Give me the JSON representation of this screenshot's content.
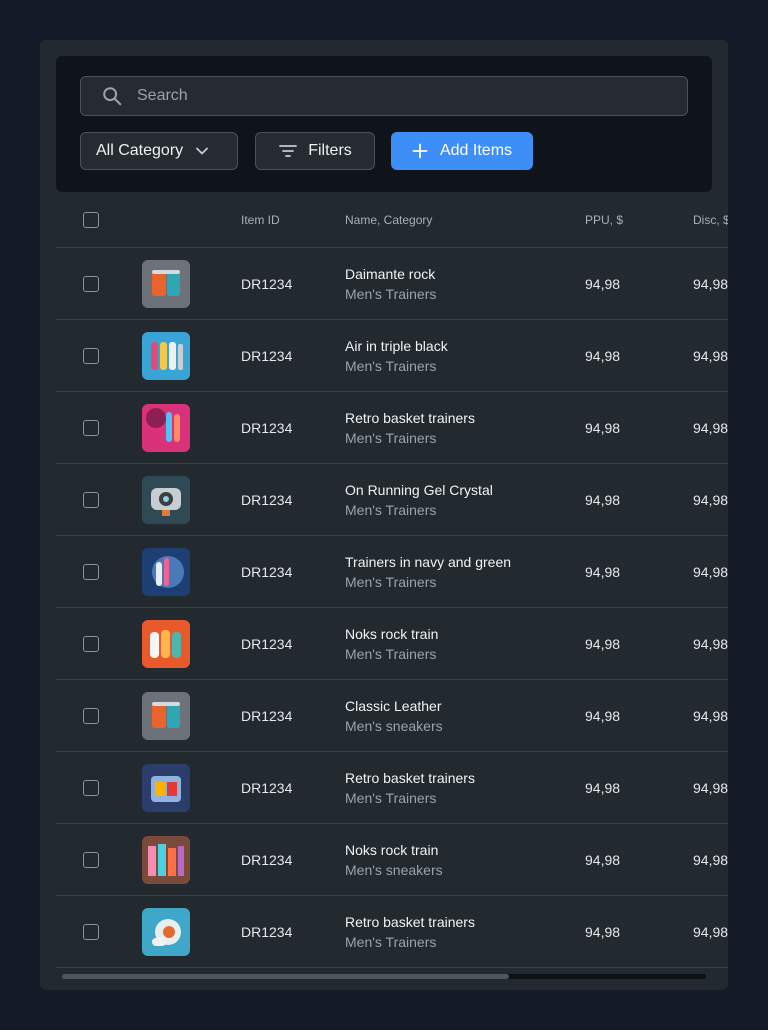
{
  "search": {
    "placeholder": "Search",
    "value": ""
  },
  "toolbar": {
    "category_label": "All Category",
    "filters_label": "Filters",
    "add_label": "Add Items"
  },
  "columns": {
    "item_id": "Item ID",
    "name_category": "Name, Category",
    "ppu": "PPU, $",
    "disc": "Disc, $"
  },
  "rows": [
    {
      "id": "DR1234",
      "name": "Daimante rock",
      "category": "Men's Trainers",
      "ppu": "94,98",
      "disc": "94,98"
    },
    {
      "id": "DR1234",
      "name": "Air in triple black",
      "category": "Men's Trainers",
      "ppu": "94,98",
      "disc": "94,98"
    },
    {
      "id": "DR1234",
      "name": "Retro basket trainers",
      "category": "Men's Trainers",
      "ppu": "94,98",
      "disc": "94,98"
    },
    {
      "id": "DR1234",
      "name": "On Running Gel Crystal",
      "category": "Men's Trainers",
      "ppu": "94,98",
      "disc": "94,98"
    },
    {
      "id": "DR1234",
      "name": "Trainers in navy and green",
      "category": "Men's Trainers",
      "ppu": "94,98",
      "disc": "94,98"
    },
    {
      "id": "DR1234",
      "name": "Noks rock train",
      "category": "Men's Trainers",
      "ppu": "94,98",
      "disc": "94,98"
    },
    {
      "id": "DR1234",
      "name": "Classic Leather",
      "category": "Men's sneakers",
      "ppu": "94,98",
      "disc": "94,98"
    },
    {
      "id": "DR1234",
      "name": "Retro basket trainers",
      "category": "Men's Trainers",
      "ppu": "94,98",
      "disc": "94,98"
    },
    {
      "id": "DR1234",
      "name": "Noks rock train",
      "category": "Men's sneakers",
      "ppu": "94,98",
      "disc": "94,98"
    },
    {
      "id": "DR1234",
      "name": "Retro basket trainers",
      "category": "Men's Trainers",
      "ppu": "94,98",
      "disc": "94,98"
    }
  ],
  "colors": {
    "accent": "#3d8ef7",
    "background": "#141a27",
    "panel": "#22292f",
    "toolbar": "#0f141b"
  },
  "icons": [
    "search-icon",
    "chevron-down-icon",
    "filter-icon",
    "plus-icon",
    "product-thumbnail"
  ]
}
